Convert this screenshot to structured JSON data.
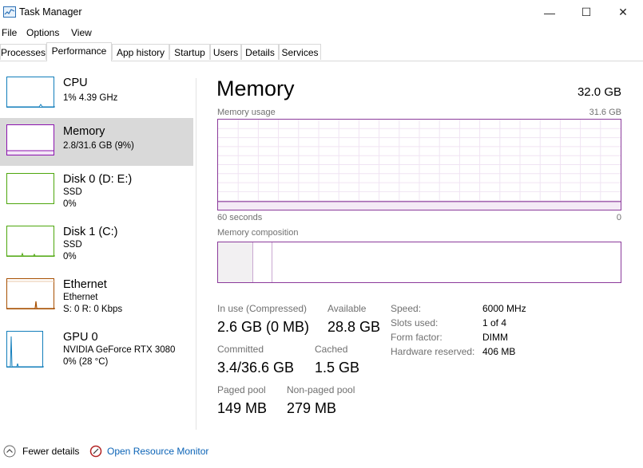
{
  "window": {
    "title": "Task Manager",
    "controls": {
      "minimize": "—",
      "maximize": "☐",
      "close": "✕"
    }
  },
  "menu": [
    "File",
    "Options",
    "View"
  ],
  "tabs": [
    "Processes",
    "Performance",
    "App history",
    "Startup",
    "Users",
    "Details",
    "Services"
  ],
  "active_tab": "Performance",
  "sidebar": {
    "items": [
      {
        "name": "CPU",
        "line1": "1% 4.39 GHz",
        "line2": "",
        "color": "#117dbb",
        "icon": "cpu-graph-icon"
      },
      {
        "name": "Memory",
        "line1": "2.8/31.6 GB (9%)",
        "line2": "",
        "color": "#8b12ae",
        "icon": "memory-graph-icon"
      },
      {
        "name": "Disk 0 (D: E:)",
        "line1": "SSD",
        "line2": "0%",
        "color": "#4da60c",
        "icon": "disk-graph-icon"
      },
      {
        "name": "Disk 1 (C:)",
        "line1": "SSD",
        "line2": "0%",
        "color": "#4da60c",
        "icon": "disk-graph-icon"
      },
      {
        "name": "Ethernet",
        "line1": "Ethernet",
        "line2": "S: 0 R: 0 Kbps",
        "color": "#a74f01",
        "icon": "ethernet-graph-icon"
      },
      {
        "name": "GPU 0",
        "line1": "NVIDIA GeForce RTX 3080",
        "line2": "0% (28 °C)",
        "color": "#117dbb",
        "icon": "gpu-graph-icon"
      }
    ]
  },
  "main": {
    "title": "Memory",
    "total": "32.0 GB",
    "usage_label": "Memory usage",
    "usage_max": "31.6 GB",
    "time_span": "60 seconds",
    "time_end": "0",
    "composition_label": "Memory composition",
    "usage_fraction": 0.09,
    "stats": {
      "in_use_label": "In use (Compressed)",
      "in_use_value": "2.6 GB (0 MB)",
      "available_label": "Available",
      "available_value": "28.8 GB",
      "committed_label": "Committed",
      "committed_value": "3.4/36.6 GB",
      "cached_label": "Cached",
      "cached_value": "1.5 GB",
      "paged_label": "Paged pool",
      "paged_value": "149 MB",
      "nonpaged_label": "Non-paged pool",
      "nonpaged_value": "279 MB"
    },
    "specs": [
      {
        "label": "Speed:",
        "value": "6000 MHz"
      },
      {
        "label": "Slots used:",
        "value": "1 of 4"
      },
      {
        "label": "Form factor:",
        "value": "DIMM"
      },
      {
        "label": "Hardware reserved:",
        "value": "406 MB"
      }
    ]
  },
  "footer": {
    "fewer_details": "Fewer details",
    "resource_monitor": "Open Resource Monitor"
  },
  "colors": {
    "memory_accent": "#8b3a9b",
    "link": "#0b63b6",
    "selected_bg": "#d9d9d9"
  }
}
